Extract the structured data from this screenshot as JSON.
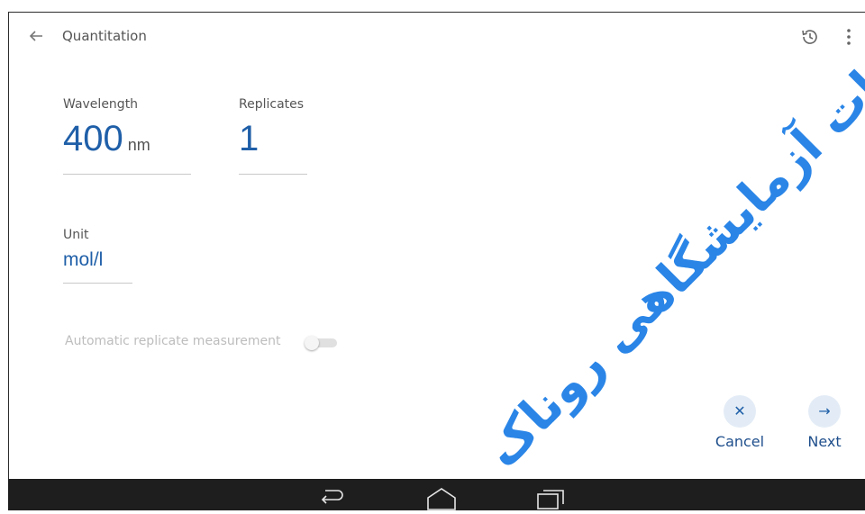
{
  "appbar": {
    "title": "Quantitation",
    "icons": {
      "back": "arrow-left-icon",
      "history": "history-icon",
      "menu": "more-vert-icon"
    }
  },
  "form": {
    "wavelength": {
      "label": "Wavelength",
      "value": "400",
      "unit": "nm"
    },
    "replicates": {
      "label": "Replicates",
      "value": "1"
    },
    "unit": {
      "label": "Unit",
      "value": "mol/l"
    },
    "auto_replicate": {
      "label": "Automatic replicate measurement",
      "enabled": false
    }
  },
  "actions": {
    "cancel": {
      "label": "Cancel",
      "icon": "close-icon",
      "glyph": "✕"
    },
    "next": {
      "label": "Next",
      "icon": "arrow-right-icon",
      "glyph": "→"
    }
  },
  "navbar": {
    "icons": [
      "back-icon",
      "home-icon",
      "recent-apps-icon"
    ]
  },
  "watermark": {
    "text": "تجهیزات آزمایشگاهی روناک"
  },
  "colors": {
    "accent": "#1f5fa8",
    "action_bg": "#e3ecf6",
    "navbar": "#1e1e1e",
    "watermark": "#1f7fe6"
  }
}
